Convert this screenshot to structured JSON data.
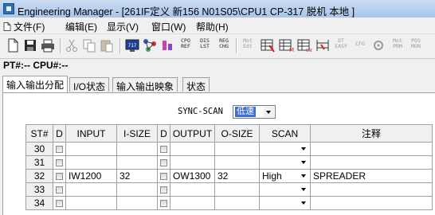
{
  "window": {
    "title": "Engineering Manager - [261IF定义    新156  N01S05\\CPU1  CP-317  脱机  本地 ]"
  },
  "menu": [
    {
      "label": "文件(F)",
      "icon": "file-doc-icon"
    },
    {
      "label": "编辑(E)",
      "icon": ""
    },
    {
      "label": "显示(V)",
      "icon": ""
    },
    {
      "label": "窗口(W)",
      "icon": ""
    },
    {
      "label": "帮助(H)",
      "icon": ""
    }
  ],
  "toolbar": {
    "cpo_ref": [
      "CPO",
      "REF"
    ],
    "dis_lst": [
      "DIS",
      "LST"
    ],
    "reg_chg": [
      "REG",
      "CHG"
    ],
    "mot_edt": [
      "Mot",
      "Edt"
    ],
    "dt_easy": [
      "DT",
      "EASY"
    ],
    "cfg": "CFG",
    "mot_prm": [
      "Mot",
      "PRM"
    ],
    "pos_mon": [
      "POS",
      "MON"
    ]
  },
  "status_line": "PT#:-- CPU#:--",
  "tabs": [
    "输入输出分配",
    "I/O状态",
    "输入输出映象",
    "状态"
  ],
  "sync_scan": {
    "label": "SYNC-SCAN",
    "value": "低速"
  },
  "table": {
    "headers": [
      "ST#",
      "D",
      "INPUT",
      "I-SIZE",
      "D",
      "OUTPUT",
      "O-SIZE",
      "SCAN",
      "注释"
    ],
    "rows": [
      {
        "st": "30",
        "input": "",
        "isize": "",
        "output": "",
        "osize": "",
        "scan": "",
        "comment": ""
      },
      {
        "st": "31",
        "input": "",
        "isize": "",
        "output": "",
        "osize": "",
        "scan": "",
        "comment": ""
      },
      {
        "st": "32",
        "input": "IW1200",
        "isize": "32",
        "output": "OW1300",
        "osize": "32",
        "scan": "High",
        "comment": "SPREADER"
      },
      {
        "st": "33",
        "input": "",
        "isize": "",
        "output": "",
        "osize": "",
        "scan": "",
        "comment": ""
      },
      {
        "st": "34",
        "input": "",
        "isize": "",
        "output": "",
        "osize": "",
        "scan": "",
        "comment": ""
      }
    ]
  }
}
